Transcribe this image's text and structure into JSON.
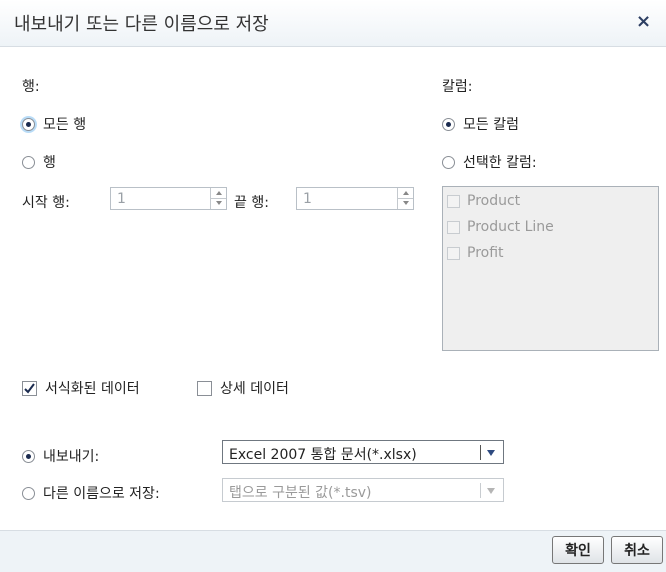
{
  "dialog": {
    "title": "내보내기 또는 다른 이름으로 저장",
    "close": "×"
  },
  "rows": {
    "heading": "행:",
    "all_rows": "모든 행",
    "rows_option": "행",
    "start_label": "시작 행:",
    "start_value": "1",
    "end_label": "끝 행:",
    "end_value": "1",
    "selected": "all_rows"
  },
  "columns": {
    "heading": "칼럼:",
    "all_columns": "모든 칼럼",
    "selected_columns": "선택한 칼럼:",
    "selected": "all_columns",
    "items": [
      {
        "label": "Product"
      },
      {
        "label": "Product Line"
      },
      {
        "label": "Profit"
      }
    ]
  },
  "options": {
    "formatted_data": "서식화된 데이터",
    "formatted_checked": true,
    "detail_data": "상세 데이터",
    "detail_checked": false
  },
  "output": {
    "export_label": "내보내기:",
    "export_value": "Excel 2007 통합 문서(*.xlsx)",
    "saveas_label": "다른 이름으로 저장:",
    "saveas_value": "탭으로 구분된 값(*.tsv)",
    "selected": "export"
  },
  "footer": {
    "ok": "확인",
    "cancel": "취소"
  }
}
